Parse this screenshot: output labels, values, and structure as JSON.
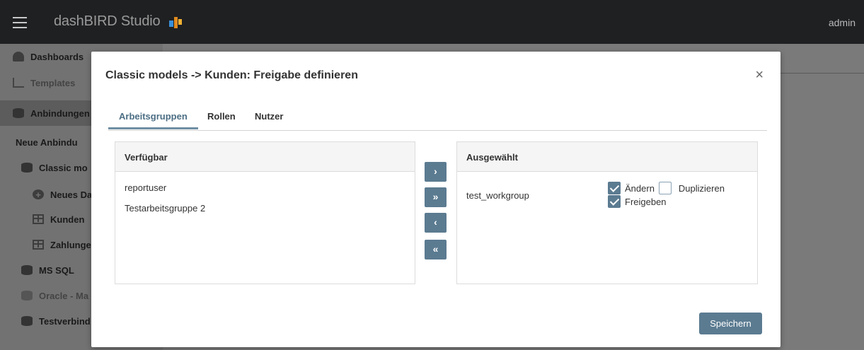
{
  "app": {
    "title": "dashBIRD Studio",
    "user": "admin"
  },
  "sidebar": {
    "items": [
      {
        "label": "Dashboards"
      },
      {
        "label": "Templates"
      },
      {
        "label": "Anbindungen"
      },
      {
        "label": "Neue Anbindu"
      },
      {
        "label": "Classic mo"
      },
      {
        "label": "Neues Da"
      },
      {
        "label": "Kunden"
      },
      {
        "label": "Zahlunge"
      },
      {
        "label": "MS SQL"
      },
      {
        "label": "Oracle - Ma"
      },
      {
        "label": "Testverbind"
      }
    ]
  },
  "modal": {
    "title": "Classic models -> Kunden: Freigabe definieren",
    "close_label": "×",
    "tabs": [
      {
        "label": "Arbeitsgruppen"
      },
      {
        "label": "Rollen"
      },
      {
        "label": "Nutzer"
      }
    ],
    "available": {
      "header": "Verfügbar",
      "items": [
        "reportuser",
        "Testarbeitsgruppe 2"
      ]
    },
    "selected": {
      "header": "Ausgewählt",
      "items": [
        {
          "name": "test_workgroup",
          "permissions": [
            {
              "label": "Ändern",
              "checked": true
            },
            {
              "label": "Duplizieren",
              "checked": false
            },
            {
              "label": "Freigeben",
              "checked": true
            }
          ]
        }
      ]
    },
    "move_buttons": {
      "add_one": "›",
      "add_all": "»",
      "remove_one": "‹",
      "remove_all": "«"
    },
    "save_label": "Speichern"
  }
}
